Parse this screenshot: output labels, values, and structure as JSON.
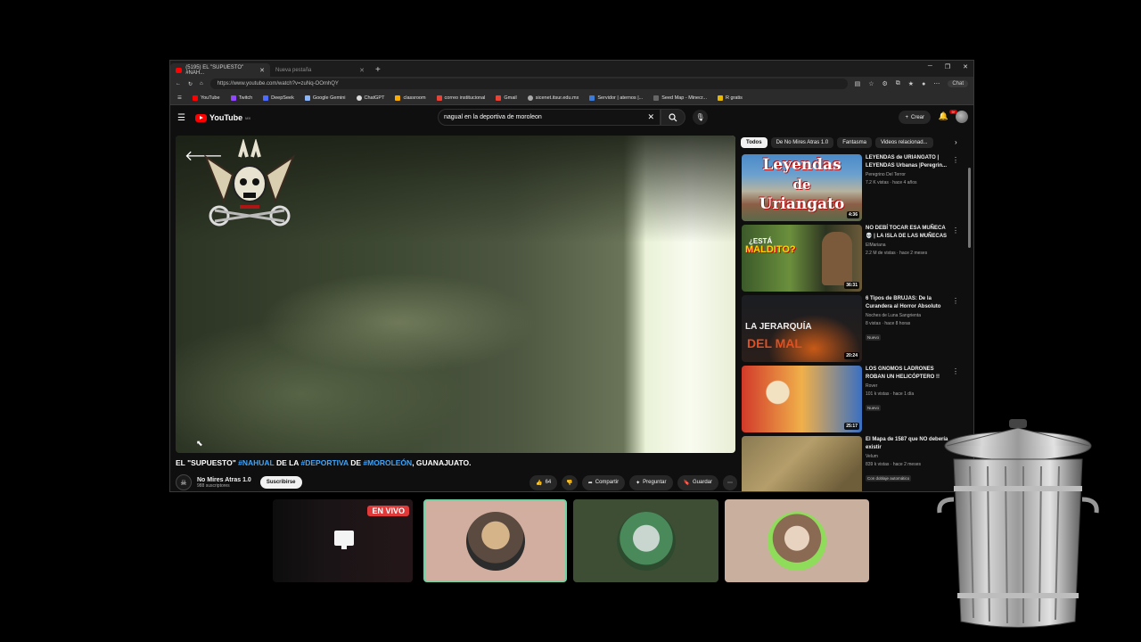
{
  "browser": {
    "tabs": [
      {
        "title": "(5195) EL \"SUPUESTO\" #NAH...",
        "active": true
      },
      {
        "title": "Nueva pestaña",
        "active": false
      }
    ],
    "url": "https://www.youtube.com/watch?v=zuNq-OOmhQY",
    "chat_label": "Chat",
    "bookmarks": [
      "YouTube",
      "Twitch",
      "DeepSeek",
      "Google Gemini",
      "ChatGPT",
      "classroom",
      "correo institucional",
      "Gmail",
      "sicenet.itsur.edu.mx",
      "Servidor | aternos |...",
      "Seed Map - Minecr...",
      "R gratis"
    ]
  },
  "youtube": {
    "logo": "YouTube",
    "logo_region": "MX",
    "search_query": "nagual en la deportiva de moroleon",
    "create_label": "Crear",
    "notifications": "9+"
  },
  "video": {
    "title_parts": [
      {
        "text": "EL \"SUPUESTO\" ",
        "tag": false
      },
      {
        "text": "#NAHUAL",
        "tag": true
      },
      {
        "text": " DE LA ",
        "tag": false
      },
      {
        "text": "#DEPORTIVA",
        "tag": true
      },
      {
        "text": " DE ",
        "tag": false
      },
      {
        "text": "#MOROLEÓN",
        "tag": true
      },
      {
        "text": ", GUANAJUATO.",
        "tag": false
      }
    ],
    "channel": "No Mires Atras 1.0",
    "subscribers": "988 suscriptores",
    "subscribe_label": "Suscribirse",
    "likes": "64",
    "share_label": "Compartir",
    "ask_label": "Preguntar",
    "save_label": "Guardar"
  },
  "chips": [
    "Todos",
    "De No Mires Atras 1.0",
    "Fantasma",
    "Videos relacionad..."
  ],
  "recommendations": [
    {
      "title": "LEYENDAS de URIANGATO | LEYENDAS Urbanas |Peregrin...",
      "channel": "Peregrino Del Terror",
      "meta": "7.2 K vistas · hace 4 años",
      "duration": "4:36",
      "thumb_text_1": "Leyendas",
      "thumb_text_2": "de",
      "thumb_text_3": "Uriangato",
      "badge": ""
    },
    {
      "title": "NO DEBÍ TOCAR ESA MUÑECA 💀 | LA ISLA DE LAS MUÑECAS",
      "channel": "ElMariana",
      "meta": "2.2 M de vistas · hace 2 meses",
      "duration": "36:31",
      "thumb_text_1": "¿ESTÁ",
      "thumb_text_2": "MALDITO?",
      "thumb_text_3": "",
      "badge": ""
    },
    {
      "title": "6 Tipos de BRUJAS: De la Curandera al Horror Absoluto",
      "channel": "Noches de Luna Sangrienta",
      "meta": "8 vistas · hace 8 horas",
      "duration": "20:24",
      "thumb_text_1": "LA JERARQUÍA",
      "thumb_text_2": "DEL MAL",
      "thumb_text_3": "",
      "badge": "Nuevo"
    },
    {
      "title": "LOS GNOMOS LADRONES ROBAN UN HELICÓPTERO !!",
      "channel": "Rover",
      "meta": "101 k vistas · hace 1 día",
      "duration": "25:17",
      "thumb_text_1": "",
      "thumb_text_2": "",
      "thumb_text_3": "",
      "badge": "Nuevo"
    },
    {
      "title": "El Mapa de 1587 que NO debería existir",
      "channel": "Velum",
      "meta": "839 k vistas · hace 2 meses",
      "duration": "",
      "thumb_text_1": "",
      "thumb_text_2": "",
      "thumb_text_3": "",
      "badge": "Con doblaje automático"
    }
  ],
  "stream": {
    "live_label": "EN VIVO"
  },
  "colors": {
    "youtube_red": "#ff0000",
    "hashtag_blue": "#3ea6ff",
    "live_red": "#e03a3a",
    "speaking_border": "#6ed4a3"
  }
}
